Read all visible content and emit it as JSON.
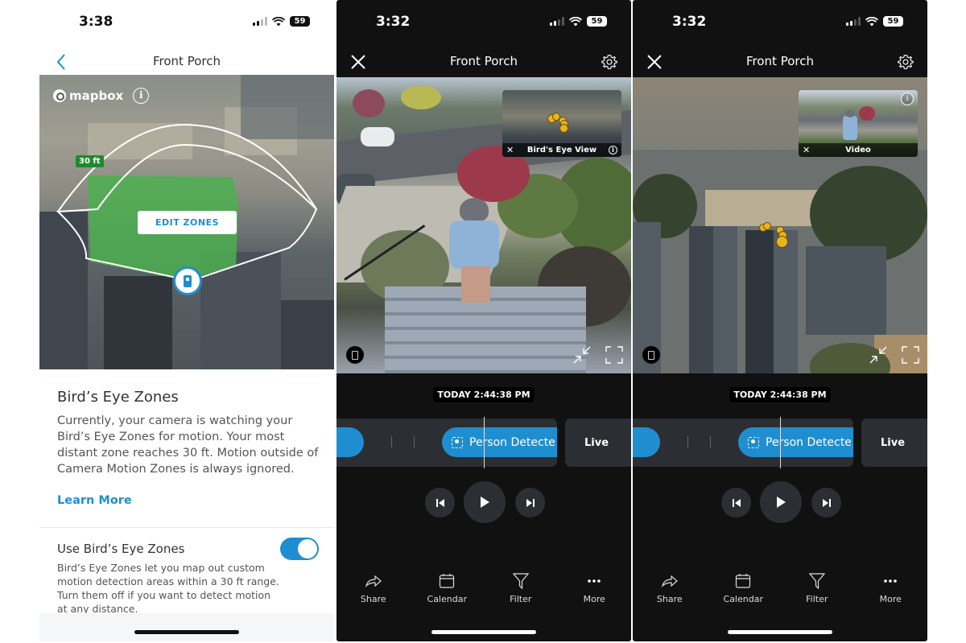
{
  "screen_settings": {
    "status": {
      "time": "3:38",
      "battery": "59"
    },
    "nav": {
      "title": "Front Porch",
      "back_icon": "chevron-left-icon"
    },
    "map": {
      "attribution": "mapbox",
      "range_badge": "30 ft",
      "edit_zones_label": "EDIT ZONES"
    },
    "section": {
      "title": "Bird’s Eye Zones",
      "description": "Currently, your camera is watching your Bird’s Eye Zones for motion. Your most distant zone reaches 30 ft. Motion outside of Camera Motion Zones is always ignored.",
      "learn_more": "Learn More"
    },
    "toggle": {
      "label": "Use Bird’s Eye Zones",
      "state": "on",
      "description": "Bird’s Eye Zones let you map out custom motion detection areas within a 30 ft range. Turn them off if you want to detect motion at any distance."
    }
  },
  "screen_video": {
    "status": {
      "time": "3:32",
      "battery": "59"
    },
    "nav": {
      "title": "Front Porch"
    },
    "pip": {
      "label": "Bird's Eye View"
    },
    "timestamp": "TODAY 2:44:38 PM",
    "timeline": {
      "event_label": "Person Detecte",
      "live_label": "Live"
    },
    "toolbar": [
      {
        "label": "Share",
        "icon": "share-icon"
      },
      {
        "label": "Calendar",
        "icon": "calendar-icon"
      },
      {
        "label": "Filter",
        "icon": "filter-icon"
      },
      {
        "label": "More",
        "icon": "more-icon"
      }
    ]
  },
  "screen_aerial": {
    "status": {
      "time": "3:32",
      "battery": "59"
    },
    "nav": {
      "title": "Front Porch"
    },
    "pip": {
      "label": "Video"
    },
    "timestamp": "TODAY 2:44:38 PM",
    "timeline": {
      "event_label": "Person Detecte",
      "live_label": "Live"
    },
    "toolbar": [
      {
        "label": "Share",
        "icon": "share-icon"
      },
      {
        "label": "Calendar",
        "icon": "calendar-icon"
      },
      {
        "label": "Filter",
        "icon": "filter-icon"
      },
      {
        "label": "More",
        "icon": "more-icon"
      }
    ]
  },
  "colors": {
    "accent_blue": "#1f8ed1",
    "zone_green": "#4caf50",
    "range_badge_green": "#1d8a2e",
    "marker_yellow": "#e7b321",
    "dark_bg": "#111111",
    "control_bg": "#2b2e32"
  }
}
